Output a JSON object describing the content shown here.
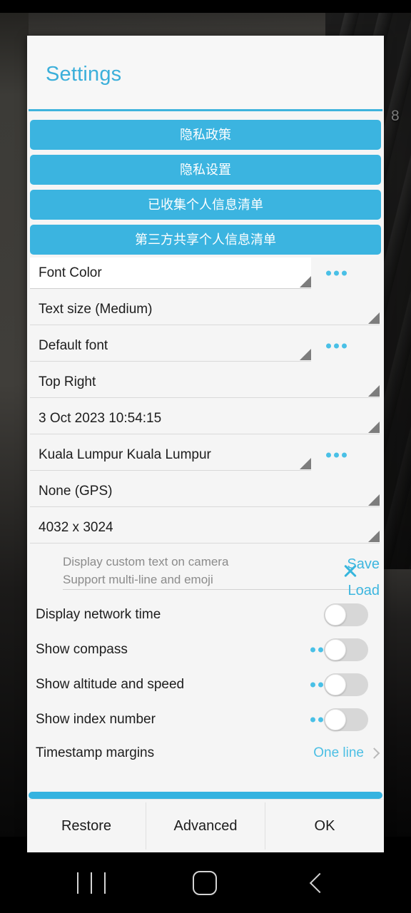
{
  "dialog": {
    "title": "Settings",
    "policy_buttons": [
      {
        "label": "隐私政策"
      },
      {
        "label": "隐私设置"
      },
      {
        "label": "已收集个人信息清单"
      },
      {
        "label": "第三方共享个人信息清单"
      }
    ],
    "spinners": [
      {
        "value": "Font Color",
        "has_dots": true,
        "highlight": true,
        "width": "narrow"
      },
      {
        "value": "Text size (Medium)",
        "has_dots": false,
        "highlight": false,
        "width": "wide"
      },
      {
        "value": "Default font",
        "has_dots": true,
        "highlight": false,
        "width": "narrow"
      },
      {
        "value": "Top Right",
        "has_dots": false,
        "highlight": false,
        "width": "wide"
      },
      {
        "value": "3 Oct 2023 10:54:15",
        "has_dots": false,
        "highlight": false,
        "width": "wide"
      },
      {
        "value": "Kuala Lumpur Kuala Lumpur",
        "has_dots": true,
        "highlight": false,
        "width": "narrow"
      },
      {
        "value": "None (GPS)",
        "has_dots": false,
        "highlight": false,
        "width": "wide"
      },
      {
        "value": "4032 x 3024",
        "has_dots": false,
        "highlight": false,
        "width": "wide"
      }
    ],
    "custom_text": {
      "placeholder_line1": "Display custom text on camera",
      "placeholder_line2": "Support multi-line and emoji",
      "value": "",
      "clear_icon": "close-icon",
      "save_label": "Save",
      "load_label": "Load"
    },
    "toggles": [
      {
        "label": "Display network time",
        "has_dots": false,
        "on": false
      },
      {
        "label": "Show compass",
        "has_dots": true,
        "on": false
      },
      {
        "label": "Show altitude and speed",
        "has_dots": true,
        "on": false
      },
      {
        "label": "Show index number",
        "has_dots": true,
        "on": false
      }
    ],
    "nav_row": {
      "label": "Timestamp margins",
      "value": "One line",
      "chevron": "chevron-right-icon"
    },
    "footer": {
      "restore_label": "Restore",
      "advanced_label": "Advanced",
      "ok_label": "OK"
    }
  },
  "background": {
    "key_label": "8"
  },
  "navbar": {
    "recents": "recents-icon",
    "home": "home-icon",
    "back": "back-icon"
  },
  "colors": {
    "accent": "#3bb4e0",
    "title": "#3bafda",
    "dialog_bg": "#f5f5f5",
    "switch_track": "#d7d7d7"
  }
}
